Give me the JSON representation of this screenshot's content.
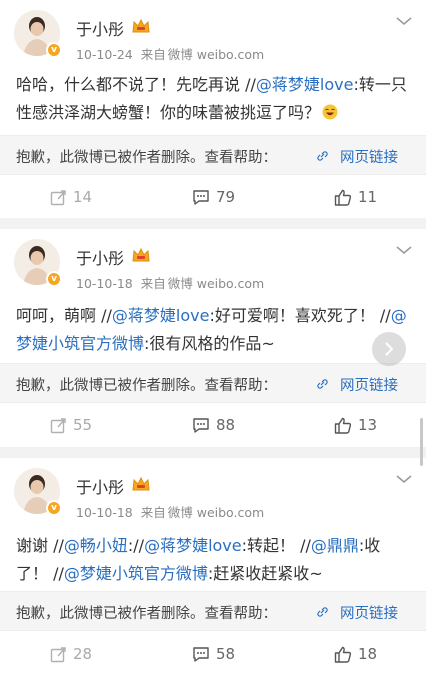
{
  "posts": [
    {
      "user": "于小彤",
      "date": "10-10-24",
      "source_prefix": "来自",
      "source": "微博 weibo.com",
      "text": [
        {
          "t": "哈哈，什么都不说了！先吃再说 //"
        },
        {
          "t": "@蒋梦婕love",
          "link": true
        },
        {
          "t": ":转一只性感洪泽湖大螃蟹！你的味蕾被挑逗了吗？"
        }
      ],
      "deleted_msg": "抱歉，此微博已被作者删除。查看帮助：",
      "web_link": "网页链接",
      "reposts": "14",
      "comments": "79",
      "likes": "11"
    },
    {
      "user": "于小彤",
      "date": "10-10-18",
      "source_prefix": "来自",
      "source": "微博 weibo.com",
      "text": [
        {
          "t": "呵呵，萌啊 //"
        },
        {
          "t": "@蒋梦婕love",
          "link": true
        },
        {
          "t": ":好可爱啊！喜欢死了！ //"
        },
        {
          "t": "@梦婕小筑官方微博",
          "link": true
        },
        {
          "t": ":很有风格的作品~"
        }
      ],
      "deleted_msg": "抱歉，此微博已被作者删除。查看帮助：",
      "web_link": "网页链接",
      "reposts": "55",
      "comments": "88",
      "likes": "13"
    },
    {
      "user": "于小彤",
      "date": "10-10-18",
      "source_prefix": "来自",
      "source": "微博 weibo.com",
      "text": [
        {
          "t": "谢谢 //"
        },
        {
          "t": "@畅小妞",
          "link": true
        },
        {
          "t": "://"
        },
        {
          "t": "@蒋梦婕love",
          "link": true
        },
        {
          "t": ":转起！ //"
        },
        {
          "t": "@鼎鼎",
          "link": true
        },
        {
          "t": ":收了！ //"
        },
        {
          "t": "@梦婕小筑官方微博",
          "link": true
        },
        {
          "t": ":赶紧收赶紧收~"
        }
      ],
      "deleted_msg": "抱歉，此微博已被作者删除。查看帮助：",
      "web_link": "网页链接",
      "reposts": "28",
      "comments": "58",
      "likes": "18"
    }
  ],
  "colors": {
    "link": "#2a6fc0",
    "badge": "#f5a623",
    "background": "#f2f2f2"
  },
  "icons": [
    "verified-badge-icon",
    "vip-crown-icon",
    "chevron-down-icon",
    "link-icon",
    "repost-icon",
    "comment-icon",
    "like-icon",
    "laugh-emoji-icon",
    "next-arrow-icon"
  ]
}
